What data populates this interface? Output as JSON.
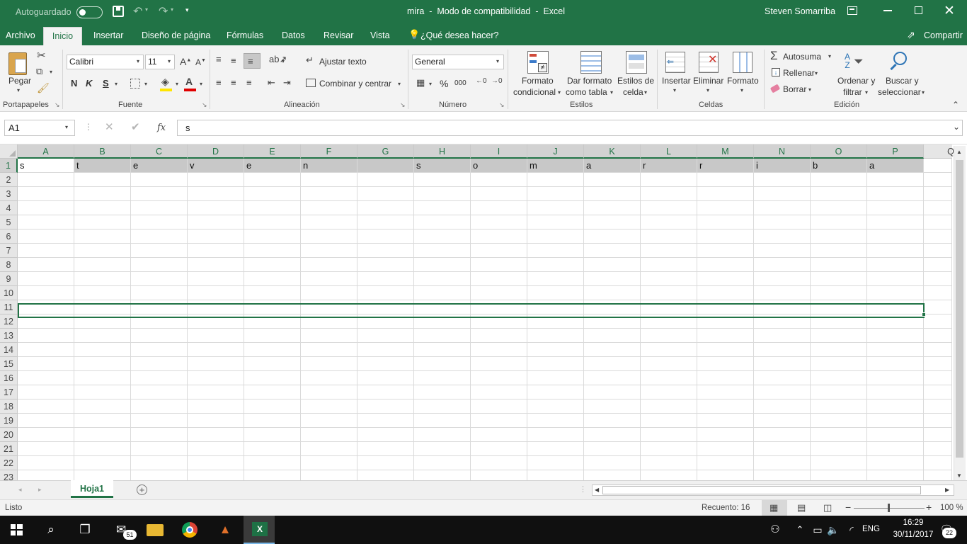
{
  "title_bar": {
    "autosave_label": "Autoguardado",
    "autosave_state": "off",
    "document_title": "mira  -  Modo de compatibilidad  -  Excel",
    "user_name": "Steven Somarriba"
  },
  "ribbon_tabs": [
    "Archivo",
    "Inicio",
    "Insertar",
    "Diseño de página",
    "Fórmulas",
    "Datos",
    "Revisar",
    "Vista"
  ],
  "active_tab": "Inicio",
  "tell_me": "¿Qué desea hacer?",
  "share_label": "Compartir",
  "clipboard": {
    "paste": "Pegar",
    "group": "Portapapeles"
  },
  "font": {
    "name": "Calibri",
    "size": "11",
    "bold": "N",
    "italic": "K",
    "underline": "S",
    "group": "Fuente"
  },
  "alignment": {
    "wrap": "Ajustar texto",
    "merge": "Combinar y centrar",
    "group": "Alineación"
  },
  "number": {
    "format": "General",
    "percent": "%",
    "thousands": "000",
    "group": "Número"
  },
  "styles": {
    "conditional_1": "Formato",
    "conditional_2": "condicional",
    "table_1": "Dar formato",
    "table_2": "como tabla",
    "cell_1": "Estilos de",
    "cell_2": "celda",
    "group": "Estilos"
  },
  "cells": {
    "insert": "Insertar",
    "delete": "Eliminar",
    "format": "Formato",
    "group": "Celdas"
  },
  "editing": {
    "autosum": "Autosuma",
    "fill": "Rellenar",
    "clear": "Borrar",
    "sort_1": "Ordenar y",
    "sort_2": "filtrar",
    "find_1": "Buscar y",
    "find_2": "seleccionar",
    "group": "Edición"
  },
  "formula_bar": {
    "name_box": "A1",
    "fx": "fx",
    "value": "s"
  },
  "columns": [
    "A",
    "B",
    "C",
    "D",
    "E",
    "F",
    "G",
    "H",
    "I",
    "J",
    "K",
    "L",
    "M",
    "N",
    "O",
    "P"
  ],
  "extra_column_partial": "Q",
  "rows": [
    "1",
    "2",
    "3",
    "4",
    "5",
    "6",
    "7",
    "8",
    "9",
    "10",
    "11",
    "12",
    "13",
    "14",
    "15",
    "16",
    "17",
    "18",
    "19",
    "20",
    "21",
    "22",
    "23"
  ],
  "row1_values": [
    "s",
    "t",
    "e",
    "v",
    "e",
    "n",
    "",
    "s",
    "o",
    "m",
    "a",
    "r",
    "r",
    "i",
    "b",
    "a"
  ],
  "sheet_tabs": [
    "Hoja1"
  ],
  "status": {
    "ready": "Listo",
    "count": "Recuento: 16",
    "zoom": "100 %"
  },
  "taskbar": {
    "mail_badge": "51",
    "language": "ENG",
    "time": "16:29",
    "date": "30/11/2017",
    "notifications": "22"
  }
}
